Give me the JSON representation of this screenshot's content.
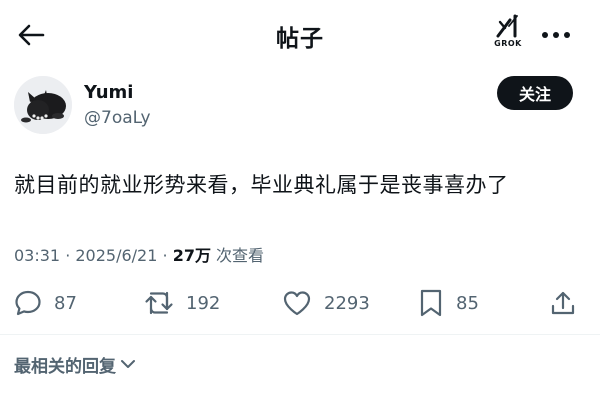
{
  "header": {
    "title": "帖子",
    "grok_label": "GROK"
  },
  "author": {
    "display_name": "Yumi",
    "handle": "@7oaLy",
    "follow_label": "关注"
  },
  "post": {
    "text": "就目前的就业形势来看，毕业典礼属于是丧事喜办了"
  },
  "meta": {
    "time": "03:31",
    "sep1": " · ",
    "date": "2025/6/21",
    "sep2": " · ",
    "views_count": "27万",
    "views_label": " 次查看"
  },
  "actions": {
    "replies": "87",
    "reposts": "192",
    "likes": "2293",
    "bookmarks": "85"
  },
  "replies_sort": {
    "label": "最相关的回复"
  },
  "icons": {
    "back": "arrow-left-icon",
    "grok": "grok-logo-icon",
    "more": "more-dots-icon",
    "reply": "reply-bubble-icon",
    "repost": "repost-icon",
    "like": "heart-icon",
    "bookmark": "bookmark-icon",
    "share": "share-icon",
    "chevron": "chevron-down-icon"
  },
  "colors": {
    "text_primary": "#0f1419",
    "text_secondary": "#536471",
    "follow_button_bg": "#0f1419",
    "follow_button_text": "#ffffff"
  }
}
